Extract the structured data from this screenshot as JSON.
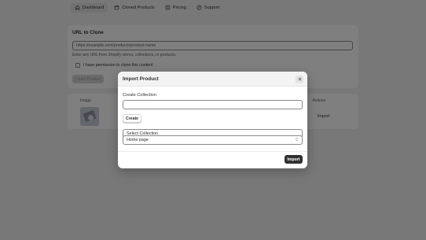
{
  "nav": {
    "tabs": [
      {
        "label": "Dashboard",
        "icon": "home-icon",
        "active": true
      },
      {
        "label": "Cloned Products",
        "icon": "product-icon",
        "active": false
      },
      {
        "label": "Pricing",
        "icon": "pricing-icon",
        "active": false
      },
      {
        "label": "Support",
        "icon": "help-icon",
        "active": false
      }
    ]
  },
  "clone_card": {
    "title": "URL to Clone",
    "url_placeholder": "https://example.com/products/product-name",
    "help_text": "Enter any URL from Shopify stores, collections, or products.",
    "permission_label": "I have permission to clone this content",
    "permission_checked": false,
    "submit_label": "Clone Product"
  },
  "table": {
    "headers": {
      "image": "Image",
      "actions": "Actions"
    },
    "rows": [
      {
        "action_label": "Import"
      }
    ]
  },
  "modal": {
    "title": "Import Product",
    "close_icon": "close-icon",
    "create_label": "Create Collection",
    "create_value": "",
    "create_button": "Create",
    "select_label": "Select Collection",
    "select_value": "Home page",
    "import_button": "Import"
  },
  "colors": {
    "overlay": "rgba(0,0,0,0.5)",
    "primary_button": "#303030",
    "surface": "#ffffff"
  }
}
